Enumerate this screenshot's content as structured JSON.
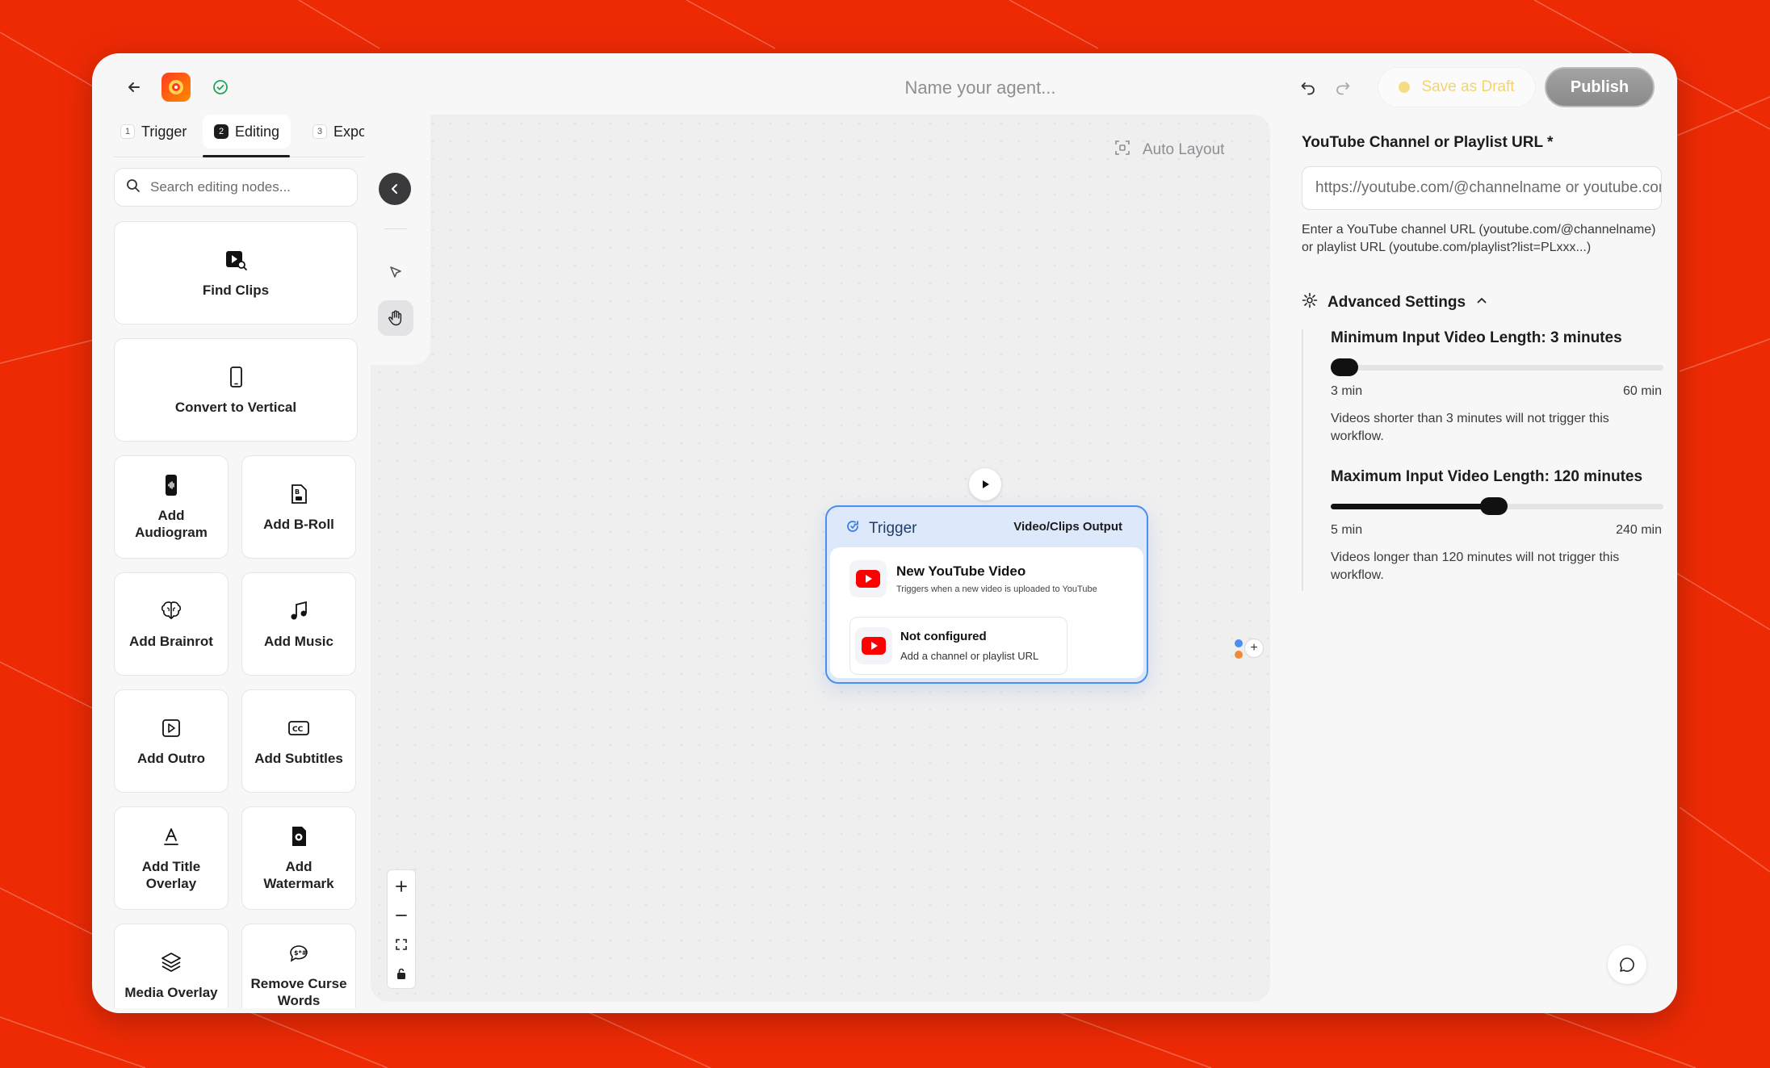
{
  "header": {
    "agent_name_placeholder": "Name your agent...",
    "save_draft_label": "Save as Draft",
    "publish_label": "Publish",
    "brand_color": "#ff4d1a"
  },
  "tabs": [
    {
      "num": "1",
      "label": "Trigger",
      "active": false
    },
    {
      "num": "2",
      "label": "Editing",
      "active": true
    },
    {
      "num": "3",
      "label": "Expor",
      "active": false
    }
  ],
  "search": {
    "placeholder": "Search editing nodes..."
  },
  "nodes": [
    {
      "label": "Find Clips",
      "icon": "find-clips-icon"
    },
    {
      "label": "Convert to Vertical",
      "icon": "phone-icon"
    },
    {
      "label": "Add Audiogram",
      "icon": "audiogram-icon"
    },
    {
      "label": "Add B-Roll",
      "icon": "broll-icon"
    },
    {
      "label": "Add Brainrot",
      "icon": "brain-icon"
    },
    {
      "label": "Add Music",
      "icon": "music-icon"
    },
    {
      "label": "Add Outro",
      "icon": "outro-icon"
    },
    {
      "label": "Add Subtitles",
      "icon": "subtitles-icon"
    },
    {
      "label": "Add Title Overlay",
      "icon": "title-icon"
    },
    {
      "label": "Add Watermark",
      "icon": "watermark-icon"
    },
    {
      "label": "Media Overlay",
      "icon": "layers-icon"
    },
    {
      "label": "Remove Curse Words",
      "icon": "curse-icon"
    }
  ],
  "canvas": {
    "auto_layout_label": "Auto Layout",
    "trigger_node": {
      "title": "Trigger",
      "output_label": "Video/Clips Output",
      "event_title": "New YouTube Video",
      "event_desc": "Triggers when a new video is uploaded to YouTube",
      "config_title": "Not configured",
      "config_desc": "Add a channel or playlist URL"
    }
  },
  "settings": {
    "url_label": "YouTube Channel or Playlist URL *",
    "url_placeholder": "https://youtube.com/@channelname or youtube.com/playlist?list=...",
    "url_help": "Enter a YouTube channel URL (youtube.com/@channelname) or playlist URL (youtube.com/playlist?list=PLxxx...)",
    "advanced_label": "Advanced Settings",
    "min_slider": {
      "title": "Minimum Input Video Length: 3 minutes",
      "min_label": "3 min",
      "max_label": "60 min",
      "range": [
        3,
        60
      ],
      "value": 3,
      "note": "Videos shorter than 3 minutes will not trigger this workflow."
    },
    "max_slider": {
      "title": "Maximum Input Video Length: 120 minutes",
      "min_label": "5 min",
      "max_label": "240 min",
      "range": [
        5,
        240
      ],
      "value": 120,
      "note": "Videos longer than 120 minutes will not trigger this workflow."
    }
  }
}
